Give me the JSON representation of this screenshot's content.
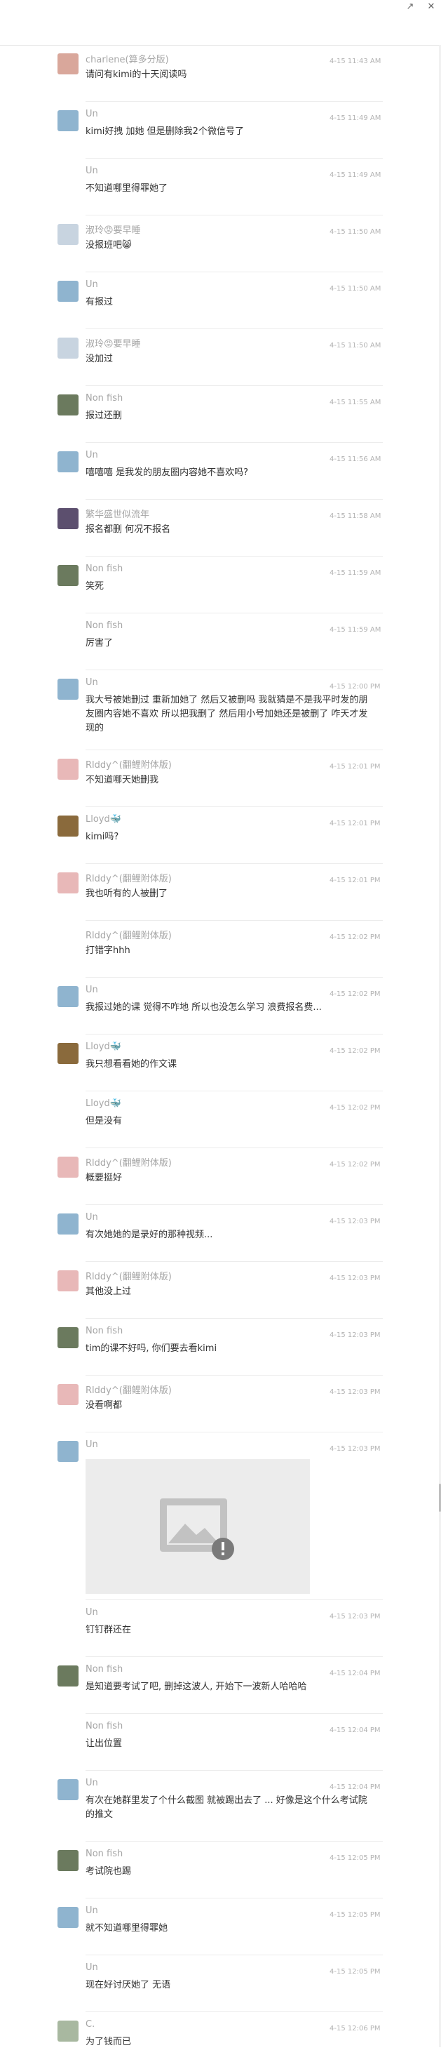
{
  "window": {
    "pin_icon": "pin-icon",
    "close_icon": "close-icon"
  },
  "colors": {
    "name": "#a6a6a6",
    "text": "#333333",
    "time": "#b3b3b3",
    "divider": "#ececec",
    "image_placeholder": "#ececec"
  },
  "messages": [
    {
      "name": "charlene(算多分版)",
      "time": "4-15 11:43 AM",
      "text": "请问有kimi的十天阅读吗",
      "avatar": "#d9a79b"
    },
    {
      "name": "Un",
      "time": "4-15 11:49 AM",
      "text": "kimi好拽 加她 但是删除我2个微信号了",
      "avatar": "#8fb4cf"
    },
    {
      "name": "Un",
      "time": "4-15 11:49 AM",
      "text": "不知道哪里得罪她了"
    },
    {
      "name": "淑玲😡要早睡",
      "time": "4-15 11:50 AM",
      "text": "没报班吧😸",
      "avatar": "#c8d4e0"
    },
    {
      "name": "Un",
      "time": "4-15 11:50 AM",
      "text": "有报过",
      "avatar": "#8fb4cf"
    },
    {
      "name": "淑玲😡要早睡",
      "time": "4-15 11:50 AM",
      "text": "没加过",
      "avatar": "#c8d4e0"
    },
    {
      "name": "Non fish",
      "time": "4-15 11:55 AM",
      "text": "报过还删",
      "avatar": "#6b7a5e"
    },
    {
      "name": "Un",
      "time": "4-15 11:56 AM",
      "text": "嘻嘻嘻 是我发的朋友圈内容她不喜欢吗?",
      "avatar": "#8fb4cf"
    },
    {
      "name": "繁华盛世似流年",
      "time": "4-15 11:58 AM",
      "text": "报名都删 何况不报名",
      "avatar": "#5c4f6e"
    },
    {
      "name": "Non fish",
      "time": "4-15 11:59 AM",
      "text": "笑死",
      "avatar": "#6b7a5e"
    },
    {
      "name": "Non fish",
      "time": "4-15 11:59 AM",
      "text": "厉害了"
    },
    {
      "name": "Un",
      "time": "4-15 12:00 PM",
      "text": "我大号被她删过 重新加她了 然后又被删吗 我就猜是不是我平时发的朋友圈内容她不喜欢 所以把我删了 然后用小号加她还是被删了 咋天才发现的",
      "avatar": "#8fb4cf"
    },
    {
      "name": "Rlddy^(翻鲤附体版)",
      "time": "4-15 12:01 PM",
      "text": "不知道哪天她删我",
      "avatar": "#e8b8b8"
    },
    {
      "name": "Lloyd🐳",
      "time": "4-15 12:01 PM",
      "text": "kimi吗?",
      "avatar": "#8a6a3c"
    },
    {
      "name": "Rlddy^(翻鲤附体版)",
      "time": "4-15 12:01 PM",
      "text": "我也听有的人被删了",
      "avatar": "#e8b8b8"
    },
    {
      "name": "Rlddy^(翻鲤附体版)",
      "time": "4-15 12:02 PM",
      "text": "打错字hhh"
    },
    {
      "name": "Un",
      "time": "4-15 12:02 PM",
      "text": "我报过她的课 觉得不咋地 所以也没怎么学习 浪费报名费...",
      "avatar": "#8fb4cf"
    },
    {
      "name": "Lloyd🐳",
      "time": "4-15 12:02 PM",
      "text": "我只想看看她的作文课",
      "avatar": "#8a6a3c"
    },
    {
      "name": "Lloyd🐳",
      "time": "4-15 12:02 PM",
      "text": "但是没有"
    },
    {
      "name": "Rlddy^(翻鲤附体版)",
      "time": "4-15 12:02 PM",
      "text": "概要挺好",
      "avatar": "#e8b8b8"
    },
    {
      "name": "Un",
      "time": "4-15 12:03 PM",
      "text": "有次她她的是录好的那种视频...",
      "avatar": "#8fb4cf"
    },
    {
      "name": "Rlddy^(翻鲤附体版)",
      "time": "4-15 12:03 PM",
      "text": "其他没上过",
      "avatar": "#e8b8b8"
    },
    {
      "name": "Non fish",
      "time": "4-15 12:03 PM",
      "text": "tim的课不好吗, 你们要去看kimi",
      "avatar": "#6b7a5e"
    },
    {
      "name": "Rlddy^(翻鲤附体版)",
      "time": "4-15 12:03 PM",
      "text": "没看啊都",
      "avatar": "#e8b8b8"
    },
    {
      "name": "Un",
      "time": "4-15 12:03 PM",
      "text": "",
      "avatar": "#8fb4cf",
      "image": true
    },
    {
      "name": "Un",
      "time": "4-15 12:03 PM",
      "text": "钉钉群还在"
    },
    {
      "name": "Non fish",
      "time": "4-15 12:04 PM",
      "text": "是知道要考试了吧, 删掉这波人, 开始下一波新人哈哈哈",
      "avatar": "#6b7a5e"
    },
    {
      "name": "Non fish",
      "time": "4-15 12:04 PM",
      "text": "让出位置"
    },
    {
      "name": "Un",
      "time": "4-15 12:04 PM",
      "text": "有次在她群里发了个什么截图 就被踢出去了 ... 好像是这个什么考试院的推文",
      "avatar": "#8fb4cf"
    },
    {
      "name": "Non fish",
      "time": "4-15 12:05 PM",
      "text": "考试院也踢",
      "avatar": "#6b7a5e"
    },
    {
      "name": "Un",
      "time": "4-15 12:05 PM",
      "text": "就不知道哪里得罪她",
      "avatar": "#8fb4cf"
    },
    {
      "name": "Un",
      "time": "4-15 12:05 PM",
      "text": "现在好讨厌她了 无语"
    },
    {
      "name": "C.",
      "time": "4-15 12:06 PM",
      "text": "为了钱而已",
      "avatar": "#a8b8a0"
    }
  ]
}
